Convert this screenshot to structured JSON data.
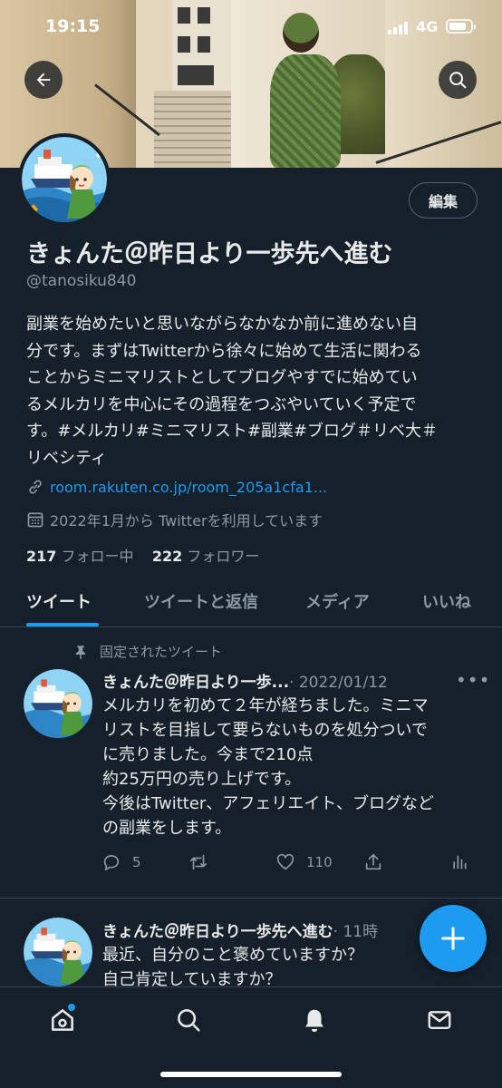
{
  "status_bar": {
    "time": "19:15",
    "network": "4G",
    "battery_level": 0.8
  },
  "header": {
    "back_icon": "arrow-left-icon",
    "search_icon": "search-icon"
  },
  "profile": {
    "edit_label": "編集",
    "display_name": "きょんた＠昨日より一歩先へ進む",
    "handle": "@tanosiku840",
    "bio_lines": [
      "副業を始めたいと思いながらなかなか前に進めない自",
      "分です。まずはTwitterから徐々に始めて生活に関わる",
      "ことからミニマリストとしてブログやすでに始めてい",
      "るメルカリを中心にその過程をつぶやいていく予定で",
      "す。#メルカリ#ミニマリスト#副業#ブログ＃リベ大＃",
      "リベシティ"
    ],
    "link": "room.rakuten.co.jp/room_205a1cfa1...",
    "joined": "2022年1月から Twitterを利用しています",
    "following_count": "217",
    "following_label": "フォロー中",
    "followers_count": "222",
    "followers_label": "フォロワー"
  },
  "tabs": [
    {
      "label": "ツイート",
      "active": true
    },
    {
      "label": "ツイートと返信",
      "active": false
    },
    {
      "label": "メディア",
      "active": false
    },
    {
      "label": "いいね",
      "active": false
    }
  ],
  "pinned_label": "固定されたツイート",
  "tweets": [
    {
      "name": "きょんた＠昨日より一歩...",
      "date": "· 2022/01/12",
      "lines": [
        "メルカリを初めて２年が経ちました。ミニマ",
        "リストを目指して要らないものを処分ついで",
        "に売りました。今まで210点",
        "約25万円の売り上げです。",
        "今後はTwitter、アフェリエイト、ブログなど",
        "の副業をします。"
      ],
      "replies": "5",
      "retweets": "",
      "likes": "110"
    },
    {
      "name": "きょんた＠昨日より一歩先へ進む",
      "date": "· 11時",
      "lines": [
        "最近、自分のこと褒めていますか？",
        "自己肯定していますか？"
      ]
    }
  ],
  "colors": {
    "background": "#15202b",
    "accent": "#1d9bf0",
    "secondary_text": "#8b98a5",
    "border": "#38444d"
  },
  "bottom_nav": [
    "home-icon",
    "search-icon",
    "bell-icon",
    "mail-icon"
  ],
  "fab_icon": "plus-icon"
}
